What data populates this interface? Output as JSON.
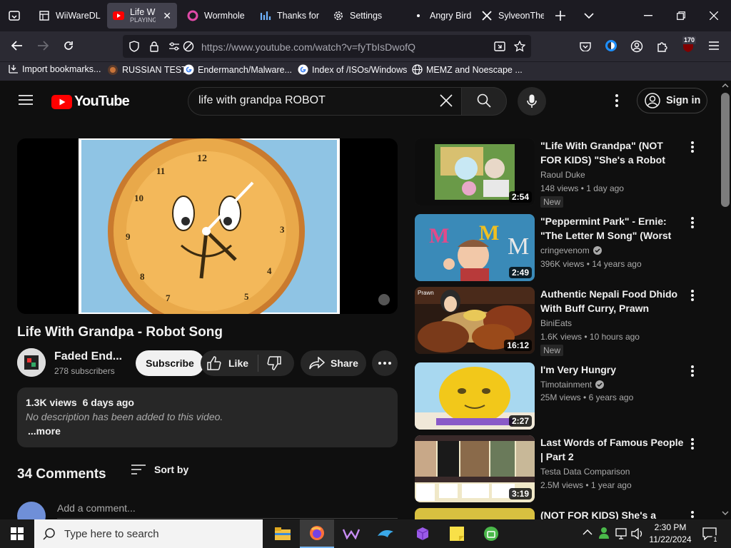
{
  "browser": {
    "tabs": [
      {
        "title": "WiiWareDL",
        "sub": "",
        "icon": "wii-icon"
      },
      {
        "title": "Life With",
        "sub": "PLAYING",
        "icon": "youtube-icon"
      },
      {
        "title": "Wormhole",
        "sub": "",
        "icon": "wormhole-icon"
      },
      {
        "title": "Thanks for",
        "sub": "",
        "icon": "chart-icon"
      },
      {
        "title": "Settings",
        "sub": "",
        "icon": "gear-icon"
      },
      {
        "title": "Angry Birds",
        "sub": "",
        "icon": "dot-icon"
      },
      {
        "title": "SylveonThe",
        "sub": "",
        "icon": "x-logo-icon"
      }
    ],
    "url": "https://www.youtube.com/watch?v=fyTbIsDwofQ",
    "extension_badge": "170",
    "bookmarks": [
      {
        "label": "Import bookmarks...",
        "icon": "import-icon"
      },
      {
        "label": "RUSSIAN TEST",
        "icon": "site-icon"
      },
      {
        "label": "Endermanch/Malware...",
        "icon": "google-icon"
      },
      {
        "label": "Index of /ISOs/Windows",
        "icon": "google-icon"
      },
      {
        "label": "MEMZ and Noescape ...",
        "icon": "globe-icon"
      }
    ]
  },
  "youtube": {
    "logo_text": "YouTube",
    "search_query": "life with grandpa ROBOT",
    "sign_in_label": "Sign in",
    "video": {
      "title": "Life With Grandpa - Robot Song",
      "channel": "Faded End...",
      "subscribers": "278 subscribers",
      "subscribe_label": "Subscribe",
      "like_label": "Like",
      "share_label": "Share",
      "views": "1.3K views",
      "age": "6 days ago",
      "description": "No description has been added to this video.",
      "more_label": "...more",
      "comments_count": "34 Comments",
      "sort_label": "Sort by",
      "add_comment_placeholder": "Add a comment..."
    },
    "related": [
      {
        "title": "\"Life With Grandpa\" (NOT FOR KIDS) \"She's a Robot Song\"",
        "channel": "Raoul Duke",
        "verified": false,
        "views": "148 views",
        "age": "1 day ago",
        "duration": "2:54",
        "badge": "New"
      },
      {
        "title": "\"Peppermint Park\" - Ernie: \"The Letter M Song\" (Worst Puppet...",
        "channel": "cringevenom",
        "verified": true,
        "views": "396K views",
        "age": "14 years ago",
        "duration": "2:49",
        "badge": ""
      },
      {
        "title": "Authentic Nepali Food Dhido With Buff Curry, Prawn Curry,...",
        "channel": "BiniEats",
        "verified": false,
        "views": "1.6K views",
        "age": "10 hours ago",
        "duration": "16:12",
        "badge": "New"
      },
      {
        "title": "I'm Very Hungry",
        "channel": "Timotainment",
        "verified": true,
        "views": "25M views",
        "age": "6 years ago",
        "duration": "2:27",
        "badge": ""
      },
      {
        "title": "Last Words of Famous People | Part 2",
        "channel": "Testa Data Comparison",
        "verified": false,
        "views": "2.5M views",
        "age": "1 year ago",
        "duration": "3:19",
        "badge": ""
      },
      {
        "title": "(NOT FOR KIDS) She's a Robot |",
        "channel": "",
        "verified": false,
        "views": "",
        "age": "",
        "duration": "",
        "badge": ""
      }
    ]
  },
  "taskbar": {
    "search_placeholder": "Type here to search",
    "time": "2:30 PM",
    "date": "11/22/2024",
    "notification_count": "1"
  }
}
